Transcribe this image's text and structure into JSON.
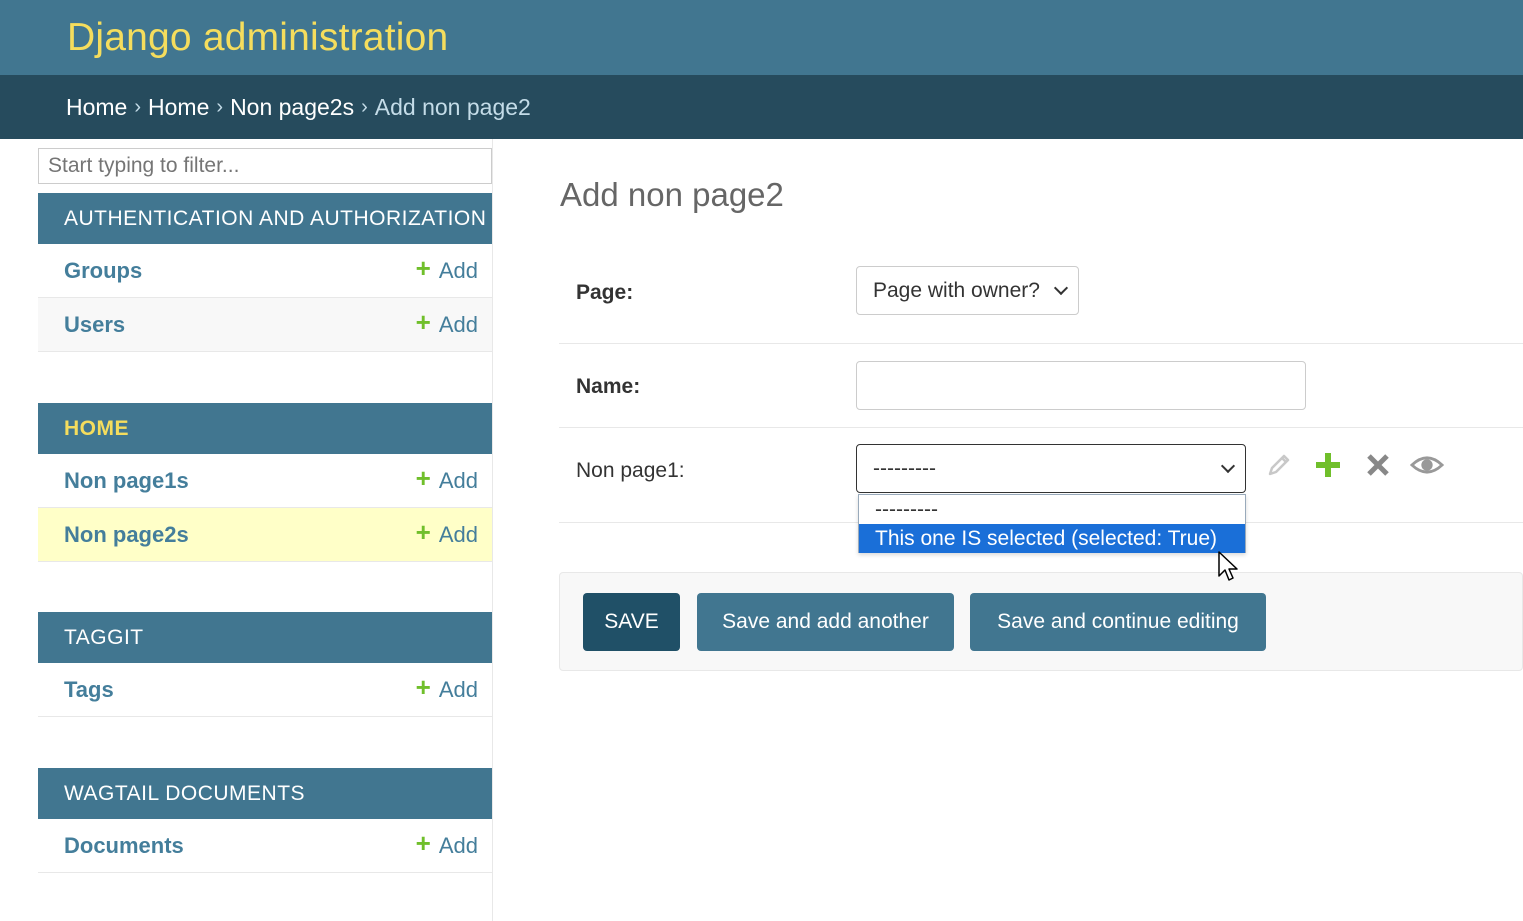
{
  "header": {
    "site_name": "Django administration"
  },
  "breadcrumbs": {
    "items": [
      "Home",
      "Home",
      "Non page2s"
    ],
    "separator": "›",
    "current": "Add non page2"
  },
  "sidebar": {
    "filter_placeholder": "Start typing to filter...",
    "add_label": "Add",
    "modules": [
      {
        "caption": "AUTHENTICATION AND AUTHORIZATION",
        "models": [
          "Groups",
          "Users"
        ]
      },
      {
        "caption": "HOME",
        "models": [
          "Non page1s",
          "Non page2s"
        ],
        "current": true,
        "selected_model": "Non page2s"
      },
      {
        "caption": "TAGGIT",
        "models": [
          "Tags"
        ]
      },
      {
        "caption": "WAGTAIL DOCUMENTS",
        "models": [
          "Documents"
        ]
      }
    ]
  },
  "main": {
    "title": "Add non page2",
    "fields": {
      "page": {
        "label": "Page:",
        "value": "Page with owner?"
      },
      "name": {
        "label": "Name:",
        "value": ""
      },
      "non_page1": {
        "label": "Non page1:",
        "value": "---------",
        "options": [
          "---------",
          "This one IS selected (selected: True)"
        ],
        "highlighted_option": "This one IS selected (selected: True)"
      }
    },
    "buttons": {
      "save": "SAVE",
      "save_add_another": "Save and add another",
      "save_continue": "Save and continue editing"
    }
  },
  "colors": {
    "header_bg": "#417690",
    "breadcrumbs_bg": "#264b5d",
    "site_name": "#f5dd5d",
    "link": "#447e9b",
    "add_plus": "#70bf2b",
    "selected_row": "#ffffc8",
    "option_highlight": "#1a6fd8"
  },
  "icons": {
    "change_related": "pencil-icon",
    "add_related": "plus-icon",
    "delete_related": "x-icon",
    "view_related": "eye-icon"
  }
}
